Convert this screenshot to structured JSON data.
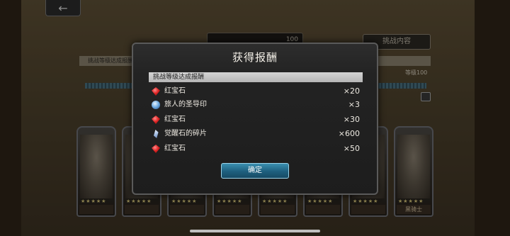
{
  "nav": {
    "back_icon": "arrow-left-icon",
    "back_glyph": "←"
  },
  "top_bar": {
    "value": "100"
  },
  "challenge_button": {
    "label": "挑战内容"
  },
  "banner": {
    "label": "挑战等级达成报酬"
  },
  "level": {
    "label": "等级100"
  },
  "cards": [
    {
      "name": ""
    },
    {
      "name": ""
    },
    {
      "name": ""
    },
    {
      "name": ""
    },
    {
      "name": ""
    },
    {
      "name": ""
    },
    {
      "name": ""
    },
    {
      "name": "黑骑士"
    }
  ],
  "modal": {
    "title": "获得报酬",
    "header": "挑战等级达成报酬",
    "rewards": [
      {
        "icon": "ruby-icon",
        "name": "红宝石",
        "qty": "×20"
      },
      {
        "icon": "seal-icon",
        "name": "旅人的圣导印",
        "qty": "×3"
      },
      {
        "icon": "ruby-icon",
        "name": "红宝石",
        "qty": "×30"
      },
      {
        "icon": "awakening-shard-icon",
        "name": "觉醒石的碎片",
        "qty": "×600"
      },
      {
        "icon": "ruby-icon",
        "name": "红宝石",
        "qty": "×50"
      }
    ],
    "confirm_label": "确定"
  },
  "colors": {
    "modal_bg": "#1d1d1d",
    "confirm_button": "#1e5f7e",
    "header_bar": "#c4c4c4"
  }
}
